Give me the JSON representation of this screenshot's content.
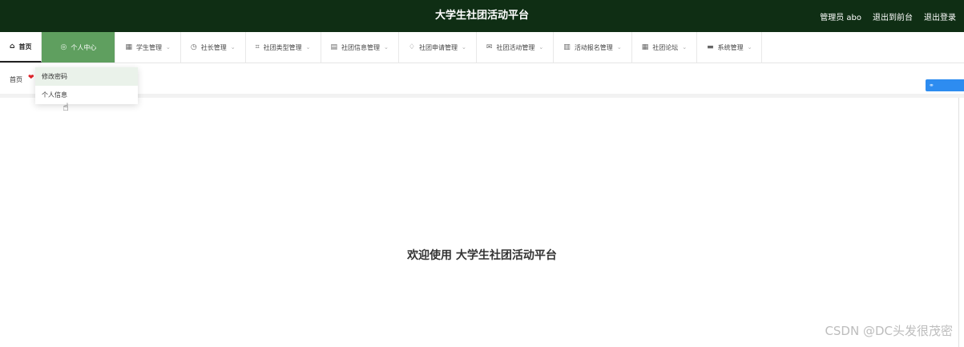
{
  "header": {
    "title": "大学生社团活动平台",
    "user": "管理员 abo",
    "to_front": "退出到前台",
    "logout": "退出登录"
  },
  "nav": [
    {
      "label": "首页",
      "icon": "home-icon",
      "glyph": "⌂"
    },
    {
      "label": "个人中心",
      "icon": "user-icon",
      "glyph": "◎"
    },
    {
      "label": "学生管理",
      "icon": "grid-icon",
      "glyph": "▦"
    },
    {
      "label": "社长管理",
      "icon": "clock-icon",
      "glyph": "◷"
    },
    {
      "label": "社团类型管理",
      "icon": "crop-icon",
      "glyph": "⌗"
    },
    {
      "label": "社团信息管理",
      "icon": "document-icon",
      "glyph": "▤"
    },
    {
      "label": "社团申请管理",
      "icon": "bell-icon",
      "glyph": "♢"
    },
    {
      "label": "社团活动管理",
      "icon": "mail-icon",
      "glyph": "✉"
    },
    {
      "label": "活动报名管理",
      "icon": "chart-icon",
      "glyph": "▥"
    },
    {
      "label": "社团论坛",
      "icon": "table-icon",
      "glyph": "▦"
    },
    {
      "label": "系统管理",
      "icon": "monitor-icon",
      "glyph": "▬"
    }
  ],
  "tags": {
    "home": "首页"
  },
  "dropdown": [
    {
      "label": "修改密码"
    },
    {
      "label": "个人信息"
    }
  ],
  "main": {
    "welcome": "欢迎使用 大学生社团活动平台"
  },
  "watermark": "CSDN @DC头发很茂密",
  "colors": {
    "header": "#0f2e14",
    "active_nav": "#5f9f5f",
    "accent": "#2d8cf0"
  }
}
